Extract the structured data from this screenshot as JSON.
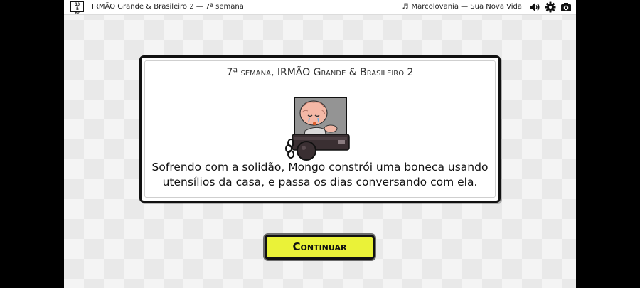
{
  "topbar": {
    "logo_lines": [
      "10",
      "&",
      "B2"
    ],
    "title": "IRMÃO Grande & Brasileiro 2 — 7ª semana",
    "music_icon": "music-note-icon",
    "music_track": "Marcolovania — Sua Nova Vida",
    "icons": [
      "speaker-icon",
      "gear-icon",
      "camera-icon"
    ]
  },
  "panel": {
    "title": "7ª semana, IRMÃO Grande & Brasileiro 2",
    "description": "Sofrendo com a solidão, Mongo constrói uma boneca usando utensílios da casa, e passa os dias conversando com ela.",
    "image_icon": "crying-character-portrait",
    "shackle_icon": "ball-and-chain-icon"
  },
  "button": {
    "label": "Continuar"
  },
  "colors": {
    "button_bg": "#eaf238",
    "panel_border": "#111111",
    "background": "#f4f4f4"
  }
}
